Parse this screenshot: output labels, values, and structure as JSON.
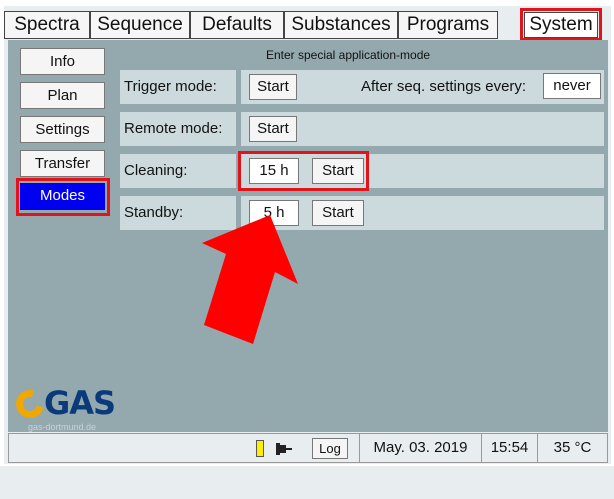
{
  "tabs": [
    {
      "label": "Spectra"
    },
    {
      "label": "Sequence"
    },
    {
      "label": "Defaults"
    },
    {
      "label": "Substances"
    },
    {
      "label": "Programs"
    },
    {
      "label": "System",
      "active": true
    }
  ],
  "sidebar": {
    "items": [
      {
        "label": "Info"
      },
      {
        "label": "Plan"
      },
      {
        "label": "Settings"
      },
      {
        "label": "Transfer"
      },
      {
        "label": "Modes",
        "active": true
      }
    ]
  },
  "main": {
    "header_note": "Enter special application-mode",
    "rows": [
      {
        "label": "Trigger mode:",
        "start_label": "Start",
        "after_seq_label": "After seq. settings every:",
        "after_seq_value": "never"
      },
      {
        "label": "Remote mode:",
        "start_label": "Start"
      },
      {
        "label": "Cleaning:",
        "hours_value": "15 h",
        "start_label": "Start"
      },
      {
        "label": "Standby:",
        "hours_value": "5 h",
        "start_label": "Start"
      }
    ]
  },
  "logo": {
    "text": "GAS",
    "sub": "gas-dortmund.de"
  },
  "statusbar": {
    "log_label": "Log",
    "date": "May. 03. 2019",
    "time": "15:54",
    "temperature": "35 °C"
  },
  "colors": {
    "content_bg": "#94a9ae",
    "row_bg": "#cddadd",
    "active_blue": "#0000f0",
    "highlight_red": "#e2141b",
    "logo_orange": "#f0a800",
    "logo_navy": "#0a3a7a"
  }
}
